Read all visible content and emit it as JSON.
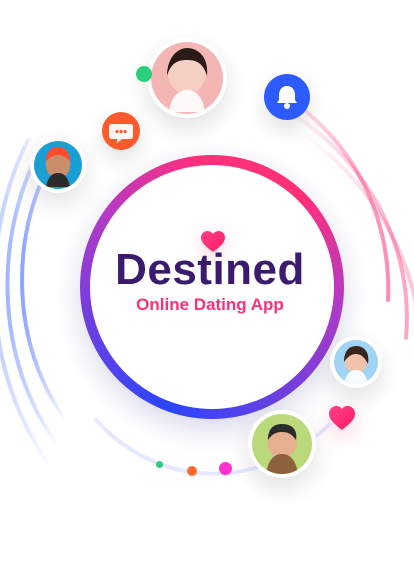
{
  "brand": {
    "name": "Destined",
    "tagline": "Online Dating App"
  },
  "colors": {
    "brand_text": "#3b1b6e",
    "accent_pink": "#ff2f7a",
    "accent_blue": "#2d5bff",
    "chat_orange": "#ff5a2e",
    "dot_green": "#2ad17a",
    "dot_orange": "#ff6b2e",
    "dot_magenta": "#ff2fd0"
  },
  "icons": {
    "center_heart": "heart-icon",
    "notification": "bell-icon",
    "chat": "chat-bubble-icon",
    "side_heart": "heart-icon"
  },
  "avatars": {
    "top_woman": "avatar",
    "left_man": "avatar",
    "right_woman": "avatar",
    "bottom_man": "avatar"
  }
}
